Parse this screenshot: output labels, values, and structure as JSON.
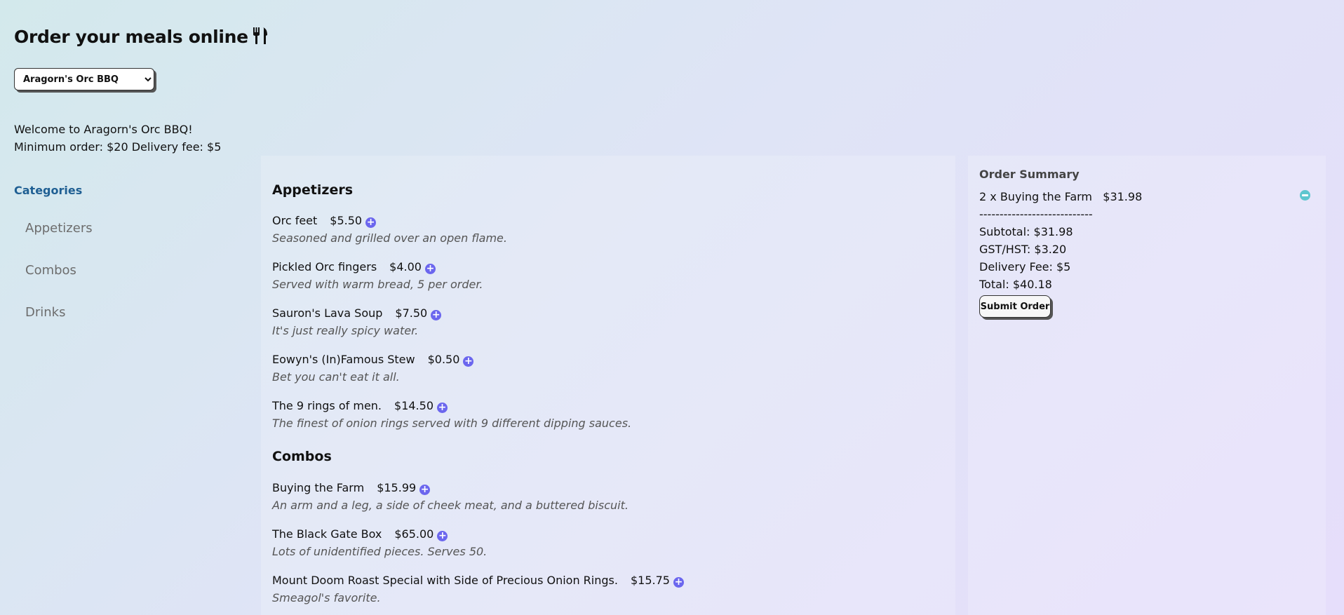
{
  "header": {
    "title": "Order your meals online"
  },
  "restaurant_select": {
    "selected": "Aragorn's Orc BBQ"
  },
  "welcome": {
    "greeting": "Welcome to Aragorn's Orc BBQ!",
    "terms": "Minimum order: $20 Delivery fee: $5"
  },
  "sidebar": {
    "heading": "Categories",
    "items": [
      {
        "label": "Appetizers"
      },
      {
        "label": "Combos"
      },
      {
        "label": "Drinks"
      }
    ]
  },
  "menu": {
    "sections": [
      {
        "title": "Appetizers",
        "items": [
          {
            "name": "Orc feet",
            "price": "$5.50",
            "description": "Seasoned and grilled over an open flame."
          },
          {
            "name": "Pickled Orc fingers",
            "price": "$4.00",
            "description": "Served with warm bread, 5 per order."
          },
          {
            "name": "Sauron's Lava Soup",
            "price": "$7.50",
            "description": "It's just really spicy water."
          },
          {
            "name": "Eowyn's (In)Famous Stew",
            "price": "$0.50",
            "description": "Bet you can't eat it all."
          },
          {
            "name": "The 9 rings of men.",
            "price": "$14.50",
            "description": "The finest of onion rings served with 9 different dipping sauces."
          }
        ]
      },
      {
        "title": "Combos",
        "items": [
          {
            "name": "Buying the Farm",
            "price": "$15.99",
            "description": "An arm and a leg, a side of cheek meat, and a buttered biscuit."
          },
          {
            "name": "The Black Gate Box",
            "price": "$65.00",
            "description": "Lots of unidentified pieces. Serves 50."
          },
          {
            "name": "Mount Doom Roast Special with Side of Precious Onion Rings.",
            "price": "$15.75",
            "description": "Smeagol's favorite."
          }
        ]
      }
    ]
  },
  "summary": {
    "title": "Order Summary",
    "line_item": "2 x Buying the Farm   $31.98",
    "divider": "----------------------------",
    "subtotal": "Subtotal: $31.98",
    "tax": "GST/HST: $3.20",
    "delivery_fee": "Delivery Fee: $5",
    "total": "Total: $40.18",
    "submit_label": "Submit Order"
  },
  "icons": {
    "title_icon": "fork-knife-icon",
    "add_icon": "plus-circle-icon",
    "remove_icon": "minus-circle-icon"
  },
  "colors": {
    "accent_add": "#6b66ee",
    "accent_remove": "#5ec6cf",
    "category_heading": "#1f5f93"
  }
}
